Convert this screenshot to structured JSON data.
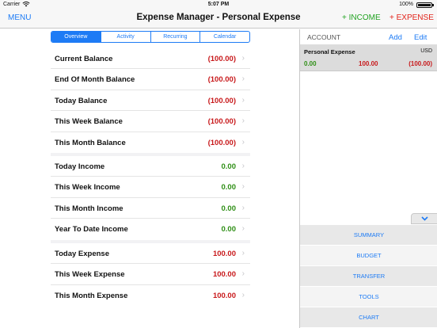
{
  "status": {
    "carrier": "Carrier",
    "time": "5:07 PM",
    "battery": "100%"
  },
  "nav": {
    "menu": "MENU",
    "title": "Expense Manager - Personal Expense",
    "income": "+ INCOME",
    "expense": "+ EXPENSE"
  },
  "tabs": [
    "Overview",
    "Activity",
    "Recurring",
    "Calendar"
  ],
  "balances": [
    {
      "label": "Current Balance",
      "value": "(100.00)"
    },
    {
      "label": "End Of Month Balance",
      "value": "(100.00)"
    },
    {
      "label": "Today Balance",
      "value": "(100.00)"
    },
    {
      "label": "This Week Balance",
      "value": "(100.00)"
    },
    {
      "label": "This Month Balance",
      "value": "(100.00)"
    }
  ],
  "income": [
    {
      "label": "Today Income",
      "value": "0.00"
    },
    {
      "label": "This Week Income",
      "value": "0.00"
    },
    {
      "label": "This Month Income",
      "value": "0.00"
    },
    {
      "label": "Year To Date Income",
      "value": "0.00"
    }
  ],
  "expenses": [
    {
      "label": "Today Expense",
      "value": "100.00"
    },
    {
      "label": "This Week Expense",
      "value": "100.00"
    },
    {
      "label": "This Month Expense",
      "value": "100.00"
    }
  ],
  "account_panel": {
    "title": "ACCOUNT",
    "add": "Add",
    "edit": "Edit",
    "account": {
      "name": "Personal Expense",
      "currency": "USD",
      "income": "0.00",
      "expense": "100.00",
      "balance": "(100.00)"
    }
  },
  "side_menu": [
    "SUMMARY",
    "BUDGET",
    "TRANSFER",
    "TOOLS",
    "CHART"
  ],
  "colors": {
    "accent": "#1d7bf5",
    "negative": "#c8191b",
    "positive": "#2f8f16"
  }
}
